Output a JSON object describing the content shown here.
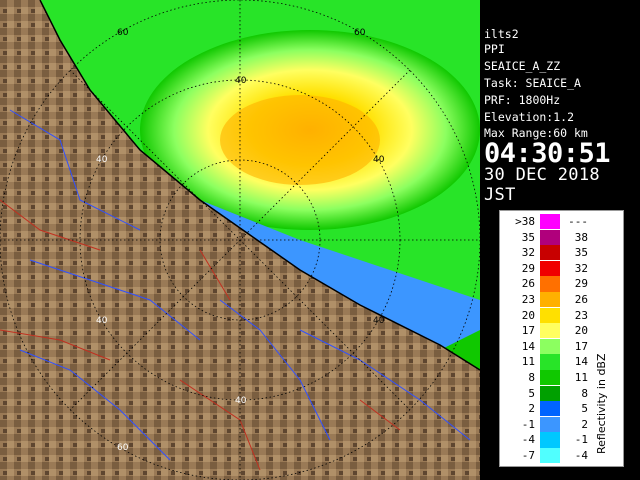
{
  "header": {
    "product": "ilts2",
    "type": "PPI",
    "task_name": "SEAICE_A_ZZ",
    "task_line": "Task: SEAICE_A",
    "prf_line": "PRF: 1800Hz",
    "elevation_line": "Elevation:1.2",
    "max_range_line": "Max Range:60 km",
    "time": "04:30:51",
    "date": "30 DEC 2018 JST"
  },
  "range_labels": [
    "40",
    "60"
  ],
  "legend": {
    "title": "Reflectivity in dBZ",
    "rows": [
      {
        "lo": ">38",
        "hi": "---",
        "color": "#ff00ff"
      },
      {
        "lo": "35",
        "hi": "38",
        "color": "#b0007c"
      },
      {
        "lo": "32",
        "hi": "35",
        "color": "#c80000"
      },
      {
        "lo": "29",
        "hi": "32",
        "color": "#f00000"
      },
      {
        "lo": "26",
        "hi": "29",
        "color": "#ff7000"
      },
      {
        "lo": "23",
        "hi": "26",
        "color": "#ffb000"
      },
      {
        "lo": "20",
        "hi": "23",
        "color": "#ffe000"
      },
      {
        "lo": "17",
        "hi": "20",
        "color": "#ffff60"
      },
      {
        "lo": "14",
        "hi": "17",
        "color": "#8cff60"
      },
      {
        "lo": "11",
        "hi": "14",
        "color": "#28e428"
      },
      {
        "lo": "8",
        "hi": "11",
        "color": "#10c800"
      },
      {
        "lo": "5",
        "hi": "8",
        "color": "#00a000"
      },
      {
        "lo": "2",
        "hi": "5",
        "color": "#0064ff"
      },
      {
        "lo": "-1",
        "hi": "2",
        "color": "#3c96ff"
      },
      {
        "lo": "-4",
        "hi": "-1",
        "color": "#00c8ff"
      },
      {
        "lo": "-7",
        "hi": "-4",
        "color": "#50ffff"
      }
    ]
  }
}
